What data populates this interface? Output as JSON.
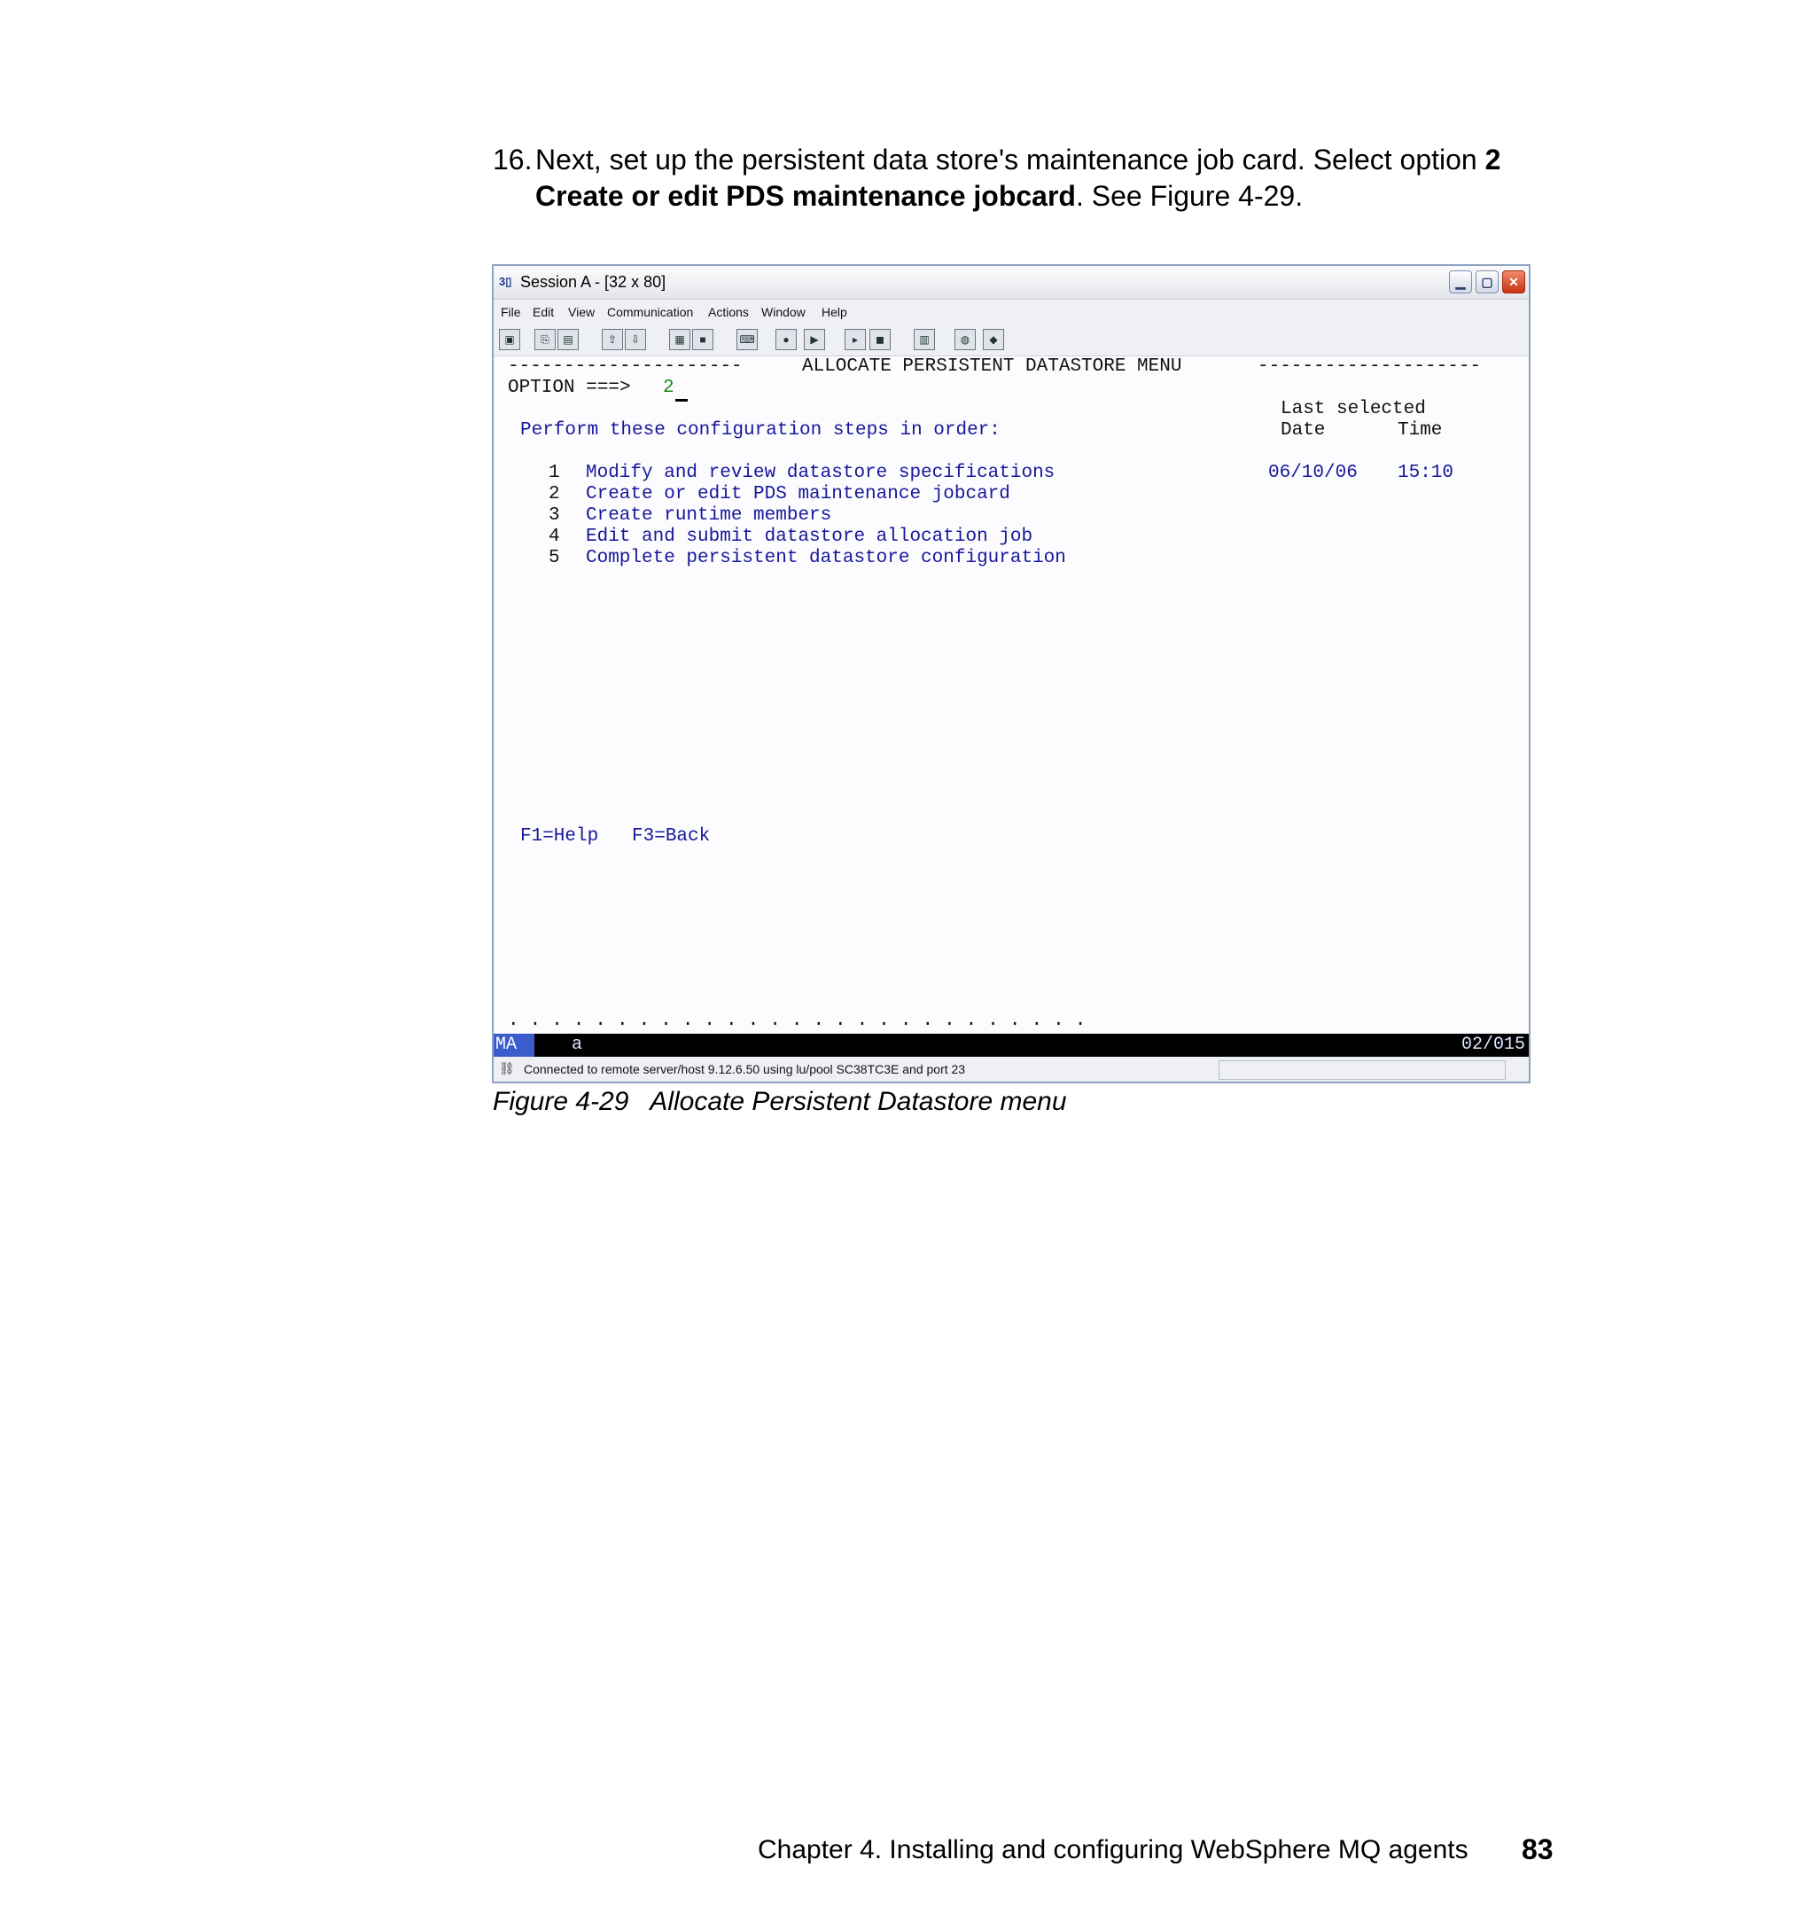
{
  "instruction": {
    "number": "16.",
    "text_before": "Next, set up the persistent data store's maintenance job card. Select option ",
    "bold_option": "2 Create or edit PDS maintenance jobcard",
    "text_after": ". See Figure 4-29."
  },
  "window": {
    "title_icon": "3270-session-icon",
    "title": "Session A - [32 x 80]",
    "controls": [
      "minimize",
      "maximize",
      "close"
    ]
  },
  "menubar": [
    "File",
    "Edit",
    "View",
    "Communication",
    "Actions",
    "Window",
    "Help"
  ],
  "toolbar_icons": [
    "print-screen-icon",
    "copy-icon",
    "paste-icon",
    "send-file-icon",
    "receive-file-icon",
    "display-icon",
    "color-icon",
    "keyboard-map-icon",
    "record-macro-icon",
    "play-macro-icon",
    "start-macro-icon",
    "stop-macro-icon",
    "clipboard-icon",
    "web-icon",
    "customize-icon"
  ],
  "screen": {
    "header_dashes_left": "---------------------",
    "header_title": "ALLOCATE PERSISTENT DATASTORE MENU",
    "header_dashes_right": "--------------------",
    "option_prompt": "OPTION ===>",
    "option_value": "2",
    "last_selected_label": "Last selected",
    "instruction": "Perform these configuration steps in order:",
    "date_header": "Date",
    "time_header": "Time",
    "steps": [
      {
        "num": "1",
        "label": "Modify and review datastore specifications",
        "date": "06/10/06",
        "time": "15:10"
      },
      {
        "num": "2",
        "label": "Create or edit PDS maintenance jobcard"
      },
      {
        "num": "3",
        "label": "Create runtime members"
      },
      {
        "num": "4",
        "label": "Edit and submit datastore allocation job"
      },
      {
        "num": "5",
        "label": "Complete persistent datastore configuration"
      }
    ],
    "function_keys": "F1=Help   F3=Back",
    "dots_row": ". . . . . . . . . . . . . . . . . . . . . . . . . . ."
  },
  "oia": {
    "mode": "MA",
    "indicator": "a",
    "cursor_position": "02/015"
  },
  "status": {
    "text": "Connected to remote server/host 9.12.6.50 using lu/pool SC38TC3E and port 23"
  },
  "caption": "Figure 4-29   Allocate Persistent Datastore menu",
  "footer": {
    "chapter": "Chapter 4. Installing and configuring WebSphere MQ agents",
    "page": "83"
  }
}
